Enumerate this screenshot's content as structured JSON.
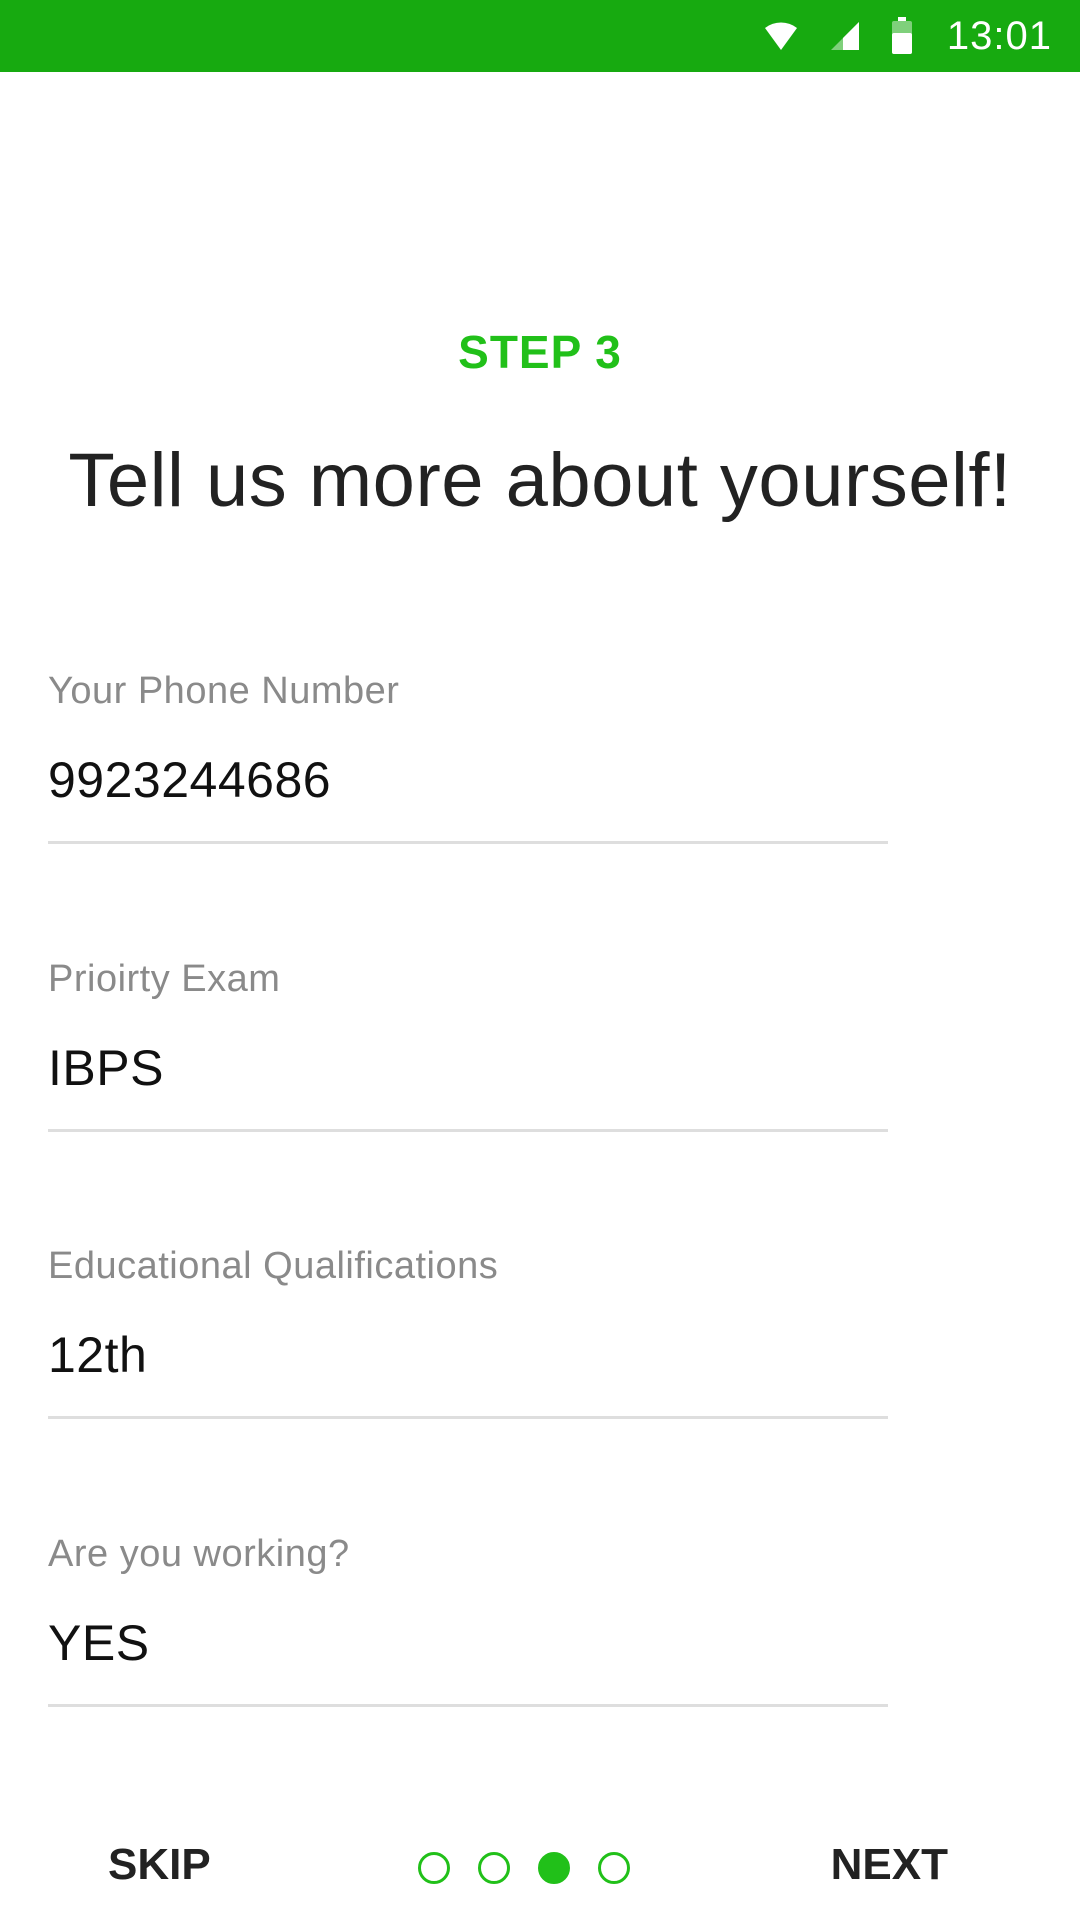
{
  "status_bar": {
    "time": "13:01",
    "icons": [
      "wifi-icon",
      "cellular-signal-icon",
      "battery-icon"
    ],
    "background": "#17aa10"
  },
  "header": {
    "step": "STEP 3",
    "title": "Tell us more about yourself!",
    "accent_color": "#21c019"
  },
  "form": {
    "phone": {
      "label": "Your Phone Number",
      "value": "9923244686"
    },
    "priority_exam": {
      "label": "Prioirty Exam",
      "value": "IBPS"
    },
    "education": {
      "label": "Educational Qualifications",
      "value": "12th"
    },
    "working": {
      "label": "Are you working?",
      "value": "YES"
    }
  },
  "footer": {
    "skip_label": "SKIP",
    "next_label": "NEXT",
    "page_indicator": {
      "total": 4,
      "current": 3
    }
  }
}
